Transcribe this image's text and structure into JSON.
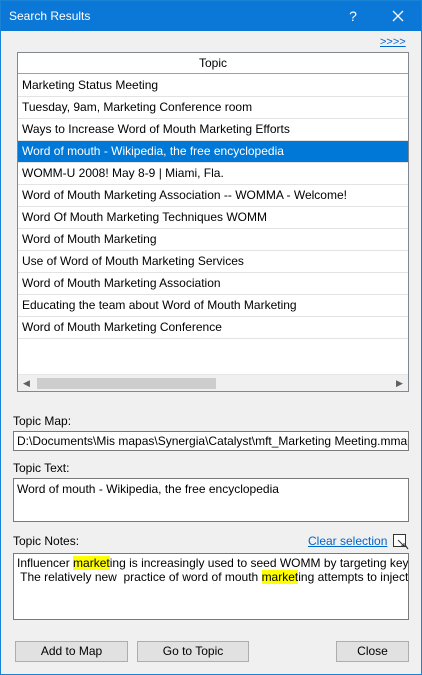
{
  "window": {
    "title": "Search Results",
    "help_label": "?"
  },
  "more_link": ">>>>",
  "results": {
    "column_header": "Topic",
    "rows": [
      "Marketing Status Meeting",
      "Tuesday, 9am, Marketing Conference room",
      "Ways to Increase Word of Mouth Marketing Efforts",
      "Word of mouth - Wikipedia, the free encyclopedia",
      "WOMM-U 2008! May 8-9 | Miami, Fla.",
      "Word of Mouth Marketing Association -- WOMMA - Welcome!",
      "Word Of Mouth Marketing Techniques WOMM",
      "Word of Mouth Marketing",
      "Use of Word of Mouth Marketing Services",
      "Word of Mouth Marketing Association",
      "Educating the team about Word of Mouth Marketing",
      "Word of Mouth Marketing Conference"
    ],
    "selected_index": 3
  },
  "topic_map": {
    "label": "Topic Map:",
    "value": "D:\\Documents\\Mis mapas\\Synergia\\Catalyst\\mft_Marketing Meeting.mmap"
  },
  "topic_text": {
    "label": "Topic Text:",
    "value": "Word of mouth - Wikipedia, the free encyclopedia"
  },
  "topic_notes": {
    "label": "Topic Notes:",
    "clear_selection": "Clear selection",
    "line1": {
      "before": "Influencer ",
      "highlight": "market",
      "after": "ing is increasingly used to seed WOMM by targeting key ..."
    },
    "line2": {
      "before": " The relatively new  practice of word of mouth ",
      "highlight": "market",
      "after": "ing attempts to inject ..."
    }
  },
  "buttons": {
    "add_to_map": "Add to Map",
    "go_to_topic": "Go to Topic",
    "close": "Close"
  },
  "icons": {
    "close": "close-icon",
    "scroll_left": "chevron-left-icon",
    "scroll_right": "chevron-right-icon",
    "notes": "notes-edit-icon"
  },
  "colors": {
    "titlebar": "#0b78d7",
    "selection": "#0078d7",
    "highlight": "#ffff00",
    "link": "#0066cc"
  }
}
